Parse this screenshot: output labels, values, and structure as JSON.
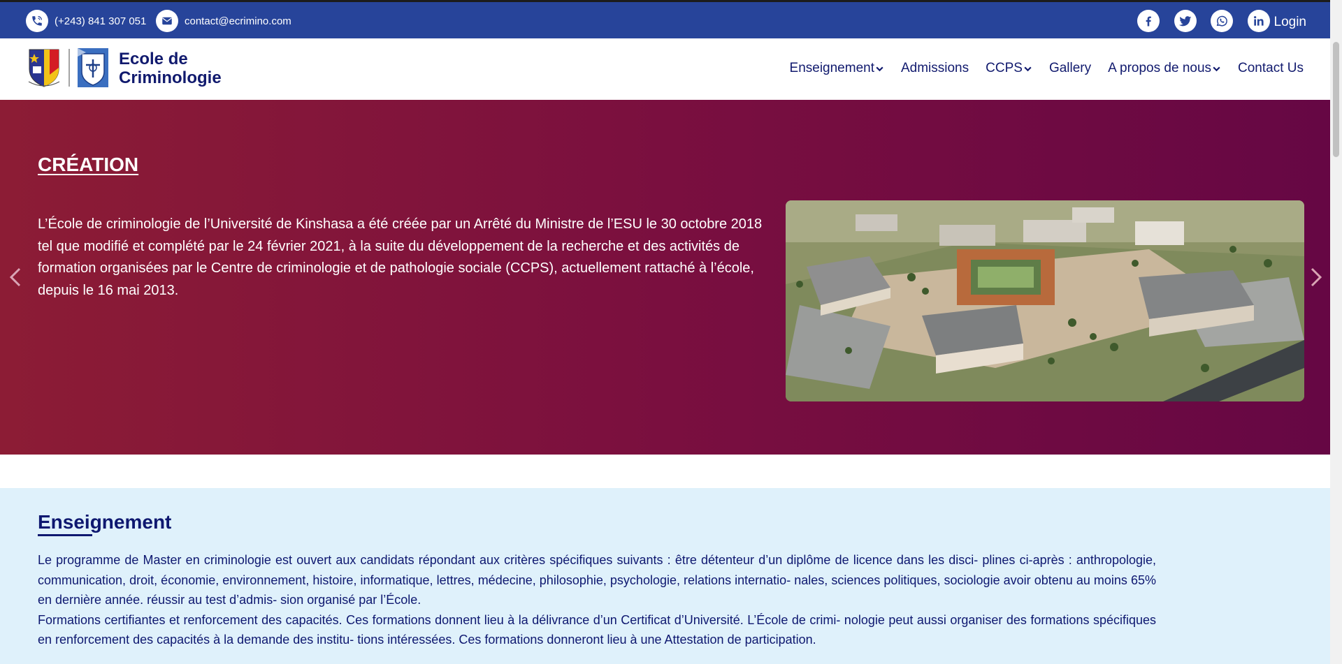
{
  "topbar": {
    "phone": "(+243) 841 307 051",
    "email": "contact@ecrimino.com",
    "login": "Login",
    "social": [
      "facebook-icon",
      "twitter-icon",
      "whatsapp-icon",
      "linkedin-icon"
    ]
  },
  "header": {
    "logo_line1": "Ecole de",
    "logo_line2": "Criminologie",
    "nav": [
      {
        "label": "Enseignement",
        "dropdown": true
      },
      {
        "label": "Admissions",
        "dropdown": false
      },
      {
        "label": "CCPS",
        "dropdown": true
      },
      {
        "label": "Gallery",
        "dropdown": false
      },
      {
        "label": "A propos de nous",
        "dropdown": true
      },
      {
        "label": "Contact Us",
        "dropdown": false
      }
    ]
  },
  "hero": {
    "title": "CRÉATION",
    "text": "L’École de criminologie de l’Université de Kinshasa a été créée par un Arrêté du Ministre de l’ESU le 30 octobre 2018 tel que modifié et complété par le 24 février 2021, à la suite du développement de la recherche et des activités de formation organisées par le Centre de criminologie et de pathologie sociale (CCPS), actuellement rattaché à l’école, depuis le 16 mai 2013."
  },
  "enseignement": {
    "title": "Enseignement",
    "paragraph1": "Le programme de Master en criminologie est ouvert aux candidats répondant aux critères spécifiques suivants : être détenteur d’un diplôme de licence dans les disci- plines ci-après : anthropologie, communication, droit, économie, environnement, histoire, informatique, lettres, médecine, philosophie, psychologie, relations internatio- nales, sciences politiques, sociologie avoir obtenu au moins 65% en dernière année. réussir au test d’admis- sion organisé par l’École.",
    "paragraph2": "Formations certifiantes et renforcement des capacités. Ces formations donnent lieu à la délivrance d’un Certificat d’Université. L’École de crimi- nologie peut aussi organiser des formations spécifiques en renforcement des capacités à la demande des institu- tions intéressées. Ces formations donneront lieu à une Attestation de participation."
  },
  "colors": {
    "topbar": "#27449a",
    "navy": "#111a6e",
    "hero_start": "#8c1c35",
    "hero_end": "#660744",
    "section_bg": "#dff1fb"
  }
}
